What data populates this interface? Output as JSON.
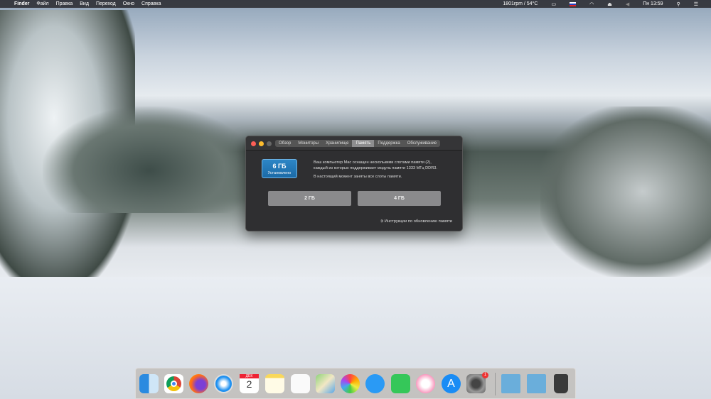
{
  "menubar": {
    "apple": "",
    "app": "Finder",
    "items": [
      "Файл",
      "Правка",
      "Вид",
      "Переход",
      "Окно",
      "Справка"
    ],
    "fan_status": "1801rpm / 54°C",
    "clock": "Пн 13:59"
  },
  "window": {
    "tabs": [
      "Обзор",
      "Мониторы",
      "Хранилище",
      "Память",
      "Поддержка",
      "Обслуживание"
    ],
    "active_tab": "Память",
    "installed_amount": "6 ГБ",
    "installed_label": "Установлено",
    "info_line1": "Ваш компьютер Mac оснащен несколькими слотами памяти (2),",
    "info_line2": "каждый из которых поддерживает модуль памяти 1333 МГц DDR3.",
    "info_line3": "В настоящий момент заняты все слоты памяти.",
    "slots": [
      "2 ГБ",
      "4 ГБ"
    ],
    "upgrade_link": "Инструкции по обновлению памяти"
  },
  "dock": {
    "apps": [
      "finder",
      "chrome",
      "firefox",
      "safari",
      "calendar",
      "notes",
      "reminders",
      "maps",
      "photos",
      "messages",
      "facetime",
      "itunes",
      "app-store",
      "system-preferences",
      "applications-folder",
      "downloads-folder",
      "trash"
    ],
    "calendar_month": "ДЕК",
    "calendar_day": "2",
    "prefs_badge": "1"
  }
}
